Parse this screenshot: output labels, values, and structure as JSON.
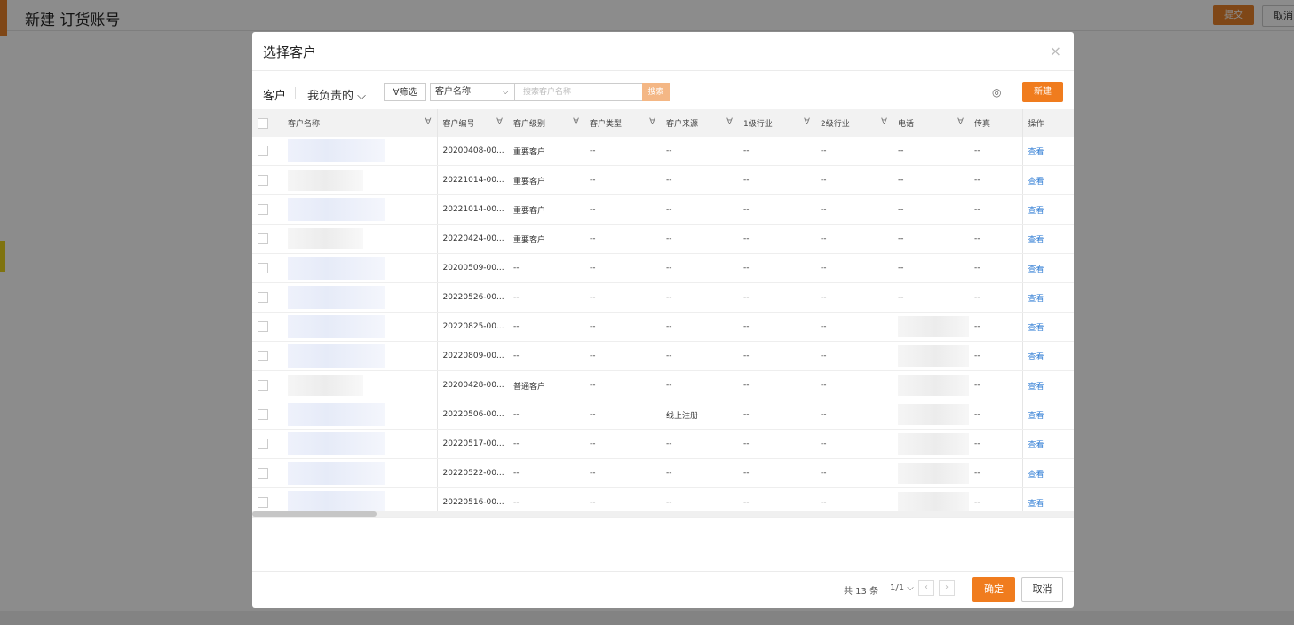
{
  "page": {
    "title": "新建 订货账号",
    "submit_label": "提交",
    "cancel_label": "取消"
  },
  "modal": {
    "title": "选择客户",
    "close_glyph": "×",
    "toolbar": {
      "customer_label": "客户",
      "scope_label": "我负责的",
      "scope_chevron": "⌵",
      "filter_label": "筛选",
      "search_field": "客户名称",
      "search_field_chevron": "⌵",
      "search_placeholder": "搜索客户名称",
      "search_button": "搜索",
      "settings_glyph": "◎",
      "new_button": "新建"
    },
    "table": {
      "columns": [
        "客户名称",
        "客户编号",
        "客户级别",
        "客户类型",
        "客户来源",
        "1级行业",
        "2级行业",
        "电话",
        "传真",
        "操作"
      ],
      "filter_glyph": "∀",
      "rows": [
        {
          "id": "20200408-00...",
          "level": "重要客户",
          "type": "--",
          "source": "--",
          "ind1": "--",
          "ind2": "--",
          "phone": "--",
          "fax": "--",
          "action": "查看"
        },
        {
          "id": "20221014-00...",
          "level": "重要客户",
          "type": "--",
          "source": "--",
          "ind1": "--",
          "ind2": "--",
          "phone": "--",
          "fax": "--",
          "action": "查看"
        },
        {
          "id": "20221014-00...",
          "level": "重要客户",
          "type": "--",
          "source": "--",
          "ind1": "--",
          "ind2": "--",
          "phone": "--",
          "fax": "--",
          "action": "查看"
        },
        {
          "id": "20220424-00...",
          "level": "重要客户",
          "type": "--",
          "source": "--",
          "ind1": "--",
          "ind2": "--",
          "phone": "--",
          "fax": "--",
          "action": "查看"
        },
        {
          "id": "20200509-00...",
          "level": "--",
          "type": "--",
          "source": "--",
          "ind1": "--",
          "ind2": "--",
          "phone": "--",
          "fax": "--",
          "action": "查看"
        },
        {
          "id": "20220526-00...",
          "level": "--",
          "type": "--",
          "source": "--",
          "ind1": "--",
          "ind2": "--",
          "phone": "--",
          "fax": "--",
          "action": "查看"
        },
        {
          "id": "20220825-00...",
          "level": "--",
          "type": "--",
          "source": "--",
          "ind1": "--",
          "ind2": "--",
          "phone": "",
          "fax": "--",
          "action": "查看"
        },
        {
          "id": "20220809-00...",
          "level": "--",
          "type": "--",
          "source": "--",
          "ind1": "--",
          "ind2": "--",
          "phone": "",
          "fax": "--",
          "action": "查看"
        },
        {
          "id": "20200428-00...",
          "level": "普通客户",
          "type": "--",
          "source": "--",
          "ind1": "--",
          "ind2": "--",
          "phone": "",
          "fax": "--",
          "action": "查看"
        },
        {
          "id": "20220506-00...",
          "level": "--",
          "type": "--",
          "source": "线上注册",
          "ind1": "--",
          "ind2": "--",
          "phone": "",
          "fax": "--",
          "action": "查看"
        },
        {
          "id": "20220517-00...",
          "level": "--",
          "type": "--",
          "source": "--",
          "ind1": "--",
          "ind2": "--",
          "phone": "",
          "fax": "--",
          "action": "查看"
        },
        {
          "id": "20220522-00...",
          "level": "--",
          "type": "--",
          "source": "--",
          "ind1": "--",
          "ind2": "--",
          "phone": "",
          "fax": "--",
          "action": "查看"
        },
        {
          "id": "20220516-00...",
          "level": "--",
          "type": "--",
          "source": "--",
          "ind1": "--",
          "ind2": "--",
          "phone": "",
          "fax": "--",
          "action": "查看"
        }
      ]
    },
    "pagination": {
      "total_text": "共 13 条",
      "page_text": "1/1 ⌵",
      "prev_glyph": "‹",
      "next_glyph": "›"
    },
    "confirm_label": "确定",
    "cancel_label": "取消"
  }
}
